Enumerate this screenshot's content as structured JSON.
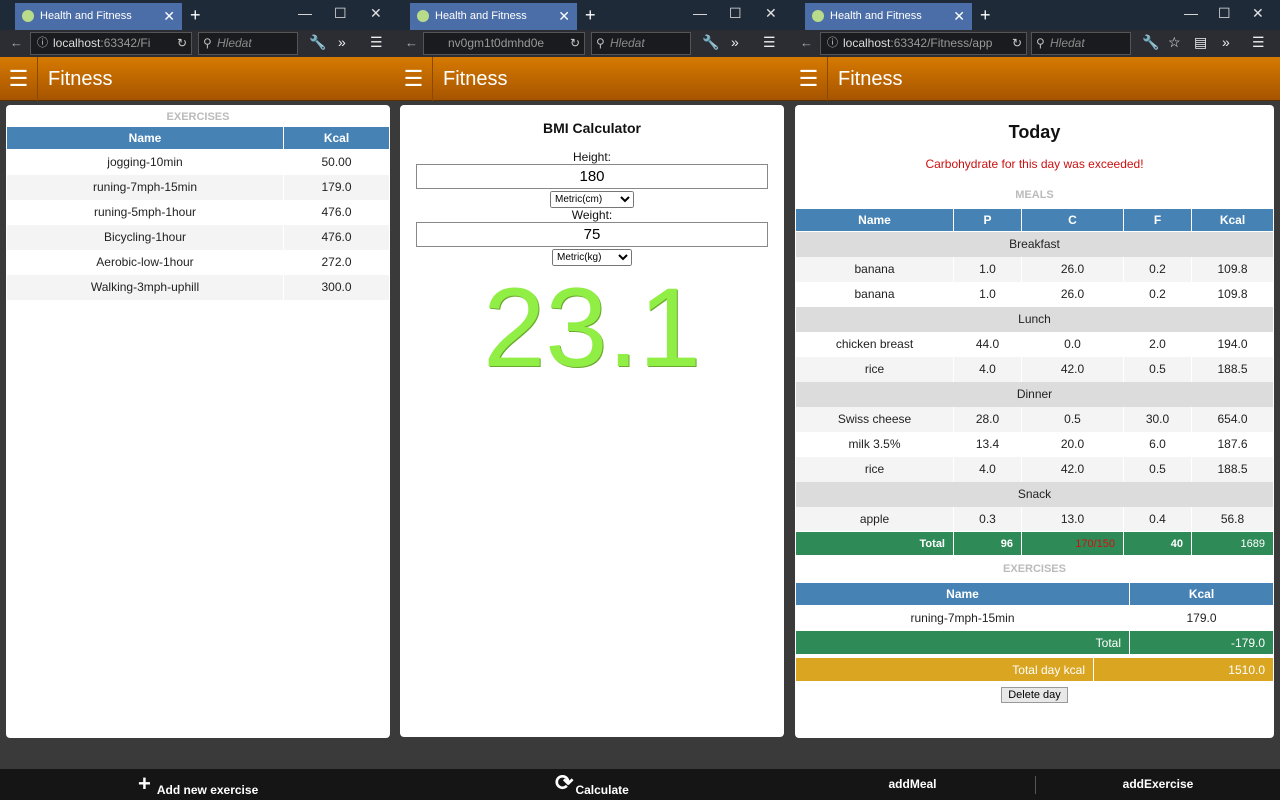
{
  "browser": {
    "tab_title": "Health and Fitness",
    "search_placeholder": "Hledat",
    "urls": {
      "w1": [
        "localhost",
        ":63342/Fi"
      ],
      "w2": [
        "",
        "nv0gm1t0dmhd0e"
      ],
      "w3": [
        "localhost",
        ":63342/Fitness/app"
      ]
    }
  },
  "app": {
    "title": "Fitness"
  },
  "exercises_page": {
    "section_label": "EXERCISES",
    "headers": [
      "Name",
      "Kcal"
    ],
    "rows": [
      [
        "jogging-10min",
        "50.00"
      ],
      [
        "runing-7mph-15min",
        "179.0"
      ],
      [
        "runing-5mph-1hour",
        "476.0"
      ],
      [
        "Bicycling-1hour",
        "476.0"
      ],
      [
        "Aerobic-low-1hour",
        "272.0"
      ],
      [
        "Walking-3mph-uphill",
        "300.0"
      ]
    ],
    "footer_label": "Add new exercise"
  },
  "bmi_page": {
    "title": "BMI Calculator",
    "height_label": "Height:",
    "height_value": "180",
    "height_unit": "Metric(cm)",
    "weight_label": "Weight:",
    "weight_value": "75",
    "weight_unit": "Metric(kg)",
    "result": "23.1",
    "result_color": "#90ee45",
    "footer_label": "Calculate"
  },
  "today_page": {
    "title": "Today",
    "warning": "Carbohydrate for this day was exceeded!",
    "meals_label": "MEALS",
    "meal_headers": [
      "Name",
      "P",
      "C",
      "F",
      "Kcal"
    ],
    "groups": [
      {
        "name": "Breakfast",
        "items": [
          [
            "banana",
            "1.0",
            "26.0",
            "0.2",
            "109.8"
          ],
          [
            "banana",
            "1.0",
            "26.0",
            "0.2",
            "109.8"
          ]
        ]
      },
      {
        "name": "Lunch",
        "items": [
          [
            "chicken breast",
            "44.0",
            "0.0",
            "2.0",
            "194.0"
          ],
          [
            "rice",
            "4.0",
            "42.0",
            "0.5",
            "188.5"
          ]
        ]
      },
      {
        "name": "Dinner",
        "items": [
          [
            "Swiss cheese",
            "28.0",
            "0.5",
            "30.0",
            "654.0"
          ],
          [
            "milk 3.5%",
            "13.4",
            "20.0",
            "6.0",
            "187.6"
          ],
          [
            "rice",
            "4.0",
            "42.0",
            "0.5",
            "188.5"
          ]
        ]
      },
      {
        "name": "Snack",
        "items": [
          [
            "apple",
            "0.3",
            "13.0",
            "0.4",
            "56.8"
          ]
        ]
      }
    ],
    "meal_total": {
      "label": "Total",
      "p": "96",
      "c": "170/150",
      "f": "40",
      "kcal": "1689"
    },
    "exercises_label": "EXERCISES",
    "exercise_headers": [
      "Name",
      "Kcal"
    ],
    "exercise_rows": [
      [
        "runing-7mph-15min",
        "179.0"
      ]
    ],
    "exercise_total": {
      "label": "Total",
      "value": "-179.0"
    },
    "day_total": {
      "label": "Total day kcal",
      "value": "1510.0"
    },
    "delete_label": "Delete day",
    "footer_left": "addMeal",
    "footer_right": "addExercise"
  },
  "colors": {
    "header_orange": "#c46a00",
    "table_header": "#4682b4",
    "total_green": "#2e8b57",
    "day_total_gold": "#daa520",
    "exceed_red": "#d01010"
  }
}
